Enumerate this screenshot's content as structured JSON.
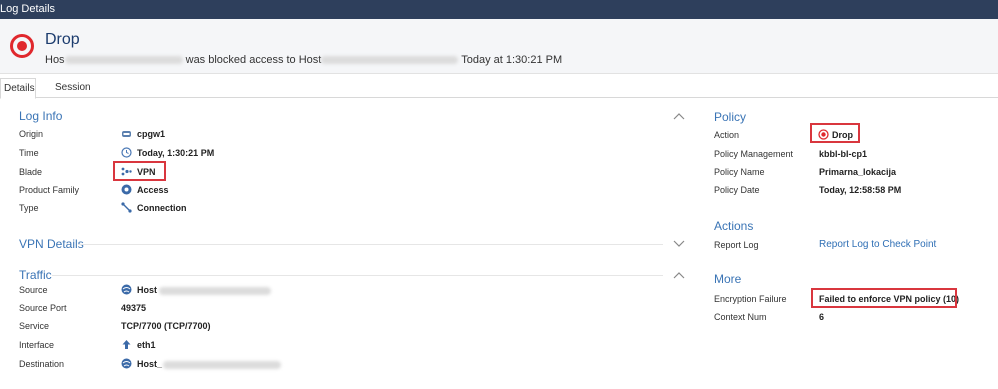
{
  "window": {
    "title": "Log Details"
  },
  "header": {
    "title": "Drop",
    "subtitle_prefix": "Hos",
    "subtitle_middle": "was blocked access to Host",
    "subtitle_suffix": "Today at  1:30:21 PM"
  },
  "tabs": [
    {
      "label": "Details",
      "active": true
    },
    {
      "label": "Session",
      "active": false
    }
  ],
  "log_info": {
    "title": "Log Info",
    "rows": [
      {
        "label": "Origin",
        "value": "cpgw1",
        "icon": "gateway-icon"
      },
      {
        "label": "Time",
        "value": "Today, 1:30:21 PM",
        "icon": "clock-icon"
      },
      {
        "label": "Blade",
        "value": "VPN",
        "icon": "vpn-icon"
      },
      {
        "label": "Product Family",
        "value": "Access",
        "icon": "access-icon"
      },
      {
        "label": "Type",
        "value": "Connection",
        "icon": "connection-icon"
      }
    ]
  },
  "vpn_details": {
    "title": "VPN Details"
  },
  "traffic": {
    "title": "Traffic",
    "rows": [
      {
        "label": "Source",
        "value": "Host",
        "icon": "host-icon"
      },
      {
        "label": "Source Port",
        "value": "49375"
      },
      {
        "label": "Service",
        "value": "TCP/7700 (TCP/7700)"
      },
      {
        "label": "Interface",
        "value": "eth1",
        "icon": "interface-arrow-icon"
      },
      {
        "label": "Destination",
        "value": "Host_",
        "icon": "host-icon"
      }
    ]
  },
  "policy": {
    "title": "Policy",
    "rows": [
      {
        "label": "Action",
        "value": "Drop",
        "icon": "drop-icon"
      },
      {
        "label": "Policy Management",
        "value": "kbbl-bl-cp1"
      },
      {
        "label": "Policy Name",
        "value": "Primarna_lokacija"
      },
      {
        "label": "Policy Date",
        "value": "Today, 12:58:58 PM"
      }
    ]
  },
  "actions": {
    "title": "Actions",
    "rows": [
      {
        "label": "Report Log",
        "link": "Report Log to Check Point"
      }
    ]
  },
  "more": {
    "title": "More",
    "rows": [
      {
        "label": "Encryption Failure",
        "value": "Failed to enforce VPN policy (10)"
      },
      {
        "label": "Context Num",
        "value": "6"
      }
    ]
  },
  "colors": {
    "titlebar": "#2e3f5c",
    "section_title": "#3a74b5",
    "drop_red": "#e0282d",
    "highlight": "#d9363e",
    "link": "#2f6fb5"
  }
}
